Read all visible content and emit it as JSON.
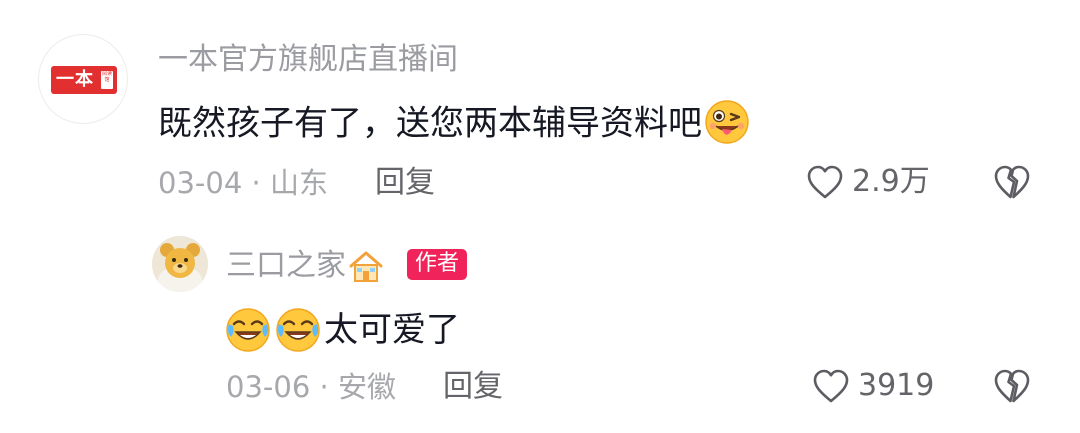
{
  "comment": {
    "username": "一本官方旗舰店直播间",
    "avatar_logo_text": "一本",
    "avatar_logo_small": "阅读馆",
    "text": "既然孩子有了，送您两本辅导资料吧",
    "emoji": "winking-tongue-face",
    "date": "03-04",
    "separator": "·",
    "location": "山东",
    "reply_label": "回复",
    "like_count": "2.9万"
  },
  "reply": {
    "username": "三口之家",
    "username_emoji": "house-icon",
    "badge": "作者",
    "text": "太可爱了",
    "emojis": [
      "crying-laughing-face",
      "crying-laughing-face"
    ],
    "date": "03-06",
    "separator": "·",
    "location": "安徽",
    "reply_label": "回复",
    "like_count": "3919"
  },
  "colors": {
    "text_primary": "#161823",
    "text_secondary": "#9b9ca1",
    "badge_bg": "#f0245a",
    "logo_red": "#e23030"
  }
}
